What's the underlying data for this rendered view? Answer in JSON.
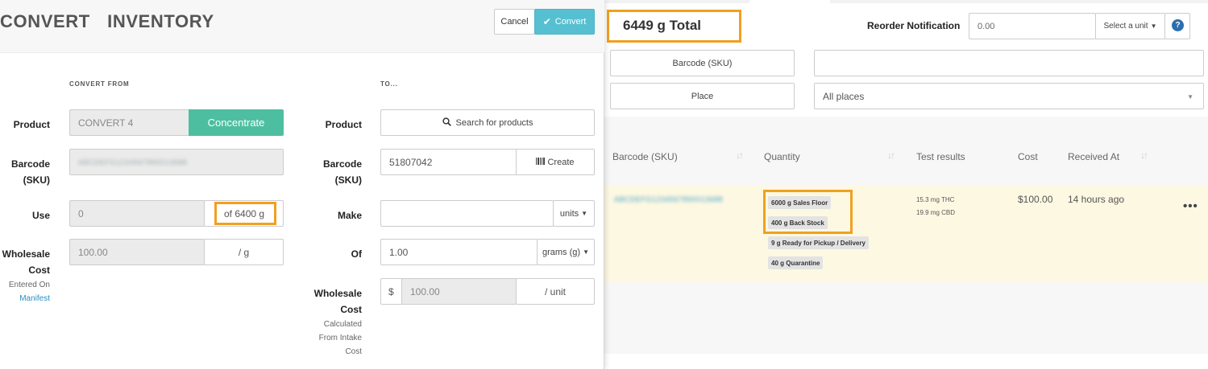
{
  "modal": {
    "title": "CONVERT  INVENTORY",
    "cancel_label": "Cancel",
    "convert_label": "Convert",
    "from_heading": "CONVERT FROM",
    "to_heading": "TO...",
    "from": {
      "product_label": "Product",
      "product_value": "CONVERT 4",
      "product_category": "Concentrate",
      "barcode_label_line1": "Barcode",
      "barcode_label_line2": "(SKU)",
      "barcode_value": "ABCDEFG1234567890013688",
      "use_label": "Use",
      "use_value": "0",
      "use_of": "of 6400 g",
      "cost_label_line1": "Wholesale",
      "cost_label_line2": "Cost",
      "cost_value": "100.00",
      "cost_unit": "/ g",
      "entered_on": "Entered On",
      "manifest_link": "Manifest"
    },
    "to": {
      "product_label": "Product",
      "search_label": "Search for products",
      "barcode_label_line1": "Barcode",
      "barcode_label_line2": "(SKU)",
      "barcode_value": "51807042",
      "create_label": "Create",
      "make_label": "Make",
      "make_unit": "units",
      "of_label": "Of",
      "of_value": "1.00",
      "of_unit": "grams (g)",
      "cost_label_line1": "Wholesale",
      "cost_label_line2": "Cost",
      "cost_note_line1": "Calculated",
      "cost_note_line2": "From Intake",
      "cost_note_line3": "Cost",
      "currency": "$",
      "cost_value": "100.00",
      "cost_unit": "/ unit"
    }
  },
  "inventory": {
    "total": "6449 g Total",
    "reorder_label": "Reorder Notification",
    "reorder_value": "0.00",
    "unit_select": "Select a unit",
    "help": "?",
    "barcode_filter_label": "Barcode (SKU)",
    "barcode_filter_value": "",
    "place_filter_label": "Place",
    "place_filter_value": "All places",
    "table": {
      "headers": [
        "Barcode (SKU)",
        "Quantity",
        "Test results",
        "Cost",
        "Received At"
      ],
      "row": {
        "barcode": "ABCDEFG1234567890013688",
        "quantities": [
          "6000 g Sales Floor",
          "400 g Back Stock",
          "9 g Ready for Pickup / Delivery",
          "40 g Quarantine"
        ],
        "thc": "15.3 mg THC",
        "cbd": "19.9 mg CBD",
        "cost": "$100.00",
        "received": "14 hours ago",
        "more": "•••"
      }
    }
  },
  "colors": {
    "accent": "#56c0d2",
    "category": "#4dbfa0",
    "highlight": "#f0a020",
    "row_bg": "#fdf8e2",
    "link": "#2a8fc4"
  }
}
